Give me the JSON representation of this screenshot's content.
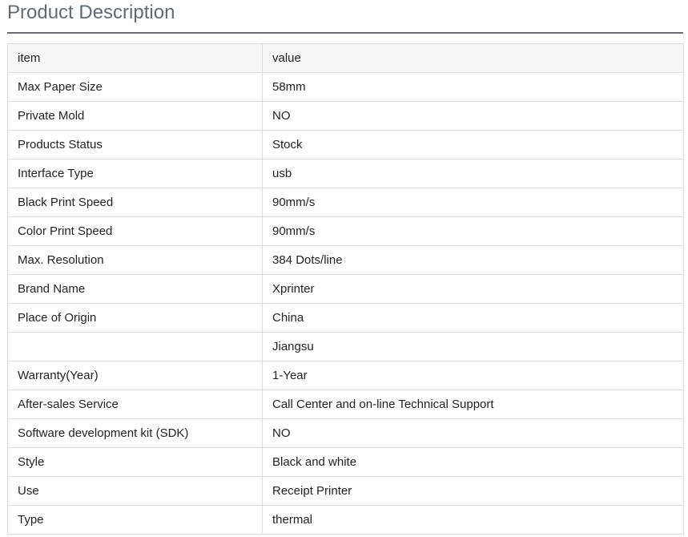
{
  "page": {
    "title": "Product Description"
  },
  "table": {
    "header": {
      "item": "item",
      "value": "value"
    },
    "rows": [
      {
        "item": "Max Paper Size",
        "value": "58mm"
      },
      {
        "item": "Private Mold",
        "value": "NO"
      },
      {
        "item": "Products Status",
        "value": "Stock"
      },
      {
        "item": "Interface Type",
        "value": "usb"
      },
      {
        "item": "Black Print Speed",
        "value": "90mm/s"
      },
      {
        "item": "Color Print Speed",
        "value": "90mm/s"
      },
      {
        "item": "Max. Resolution",
        "value": "384 Dots/line"
      },
      {
        "item": "Brand Name",
        "value": "Xprinter"
      },
      {
        "item": "Place of Origin",
        "value": "China"
      },
      {
        "item": "",
        "value": "Jiangsu"
      },
      {
        "item": "Warranty(Year)",
        "value": "1-Year"
      },
      {
        "item": "After-sales Service",
        "value": "Call Center and on-line Technical Support"
      },
      {
        "item": "Software development kit (SDK)",
        "value": "NO"
      },
      {
        "item": "Style",
        "value": "Black and white"
      },
      {
        "item": "Use",
        "value": "Receipt Printer"
      },
      {
        "item": "Type",
        "value": "thermal"
      }
    ]
  },
  "colors": {
    "title": "#5f6a78",
    "rule": "#666c75",
    "border": "#dcdcdc",
    "header_bg": "#f7f7f7",
    "text": "#222222"
  }
}
